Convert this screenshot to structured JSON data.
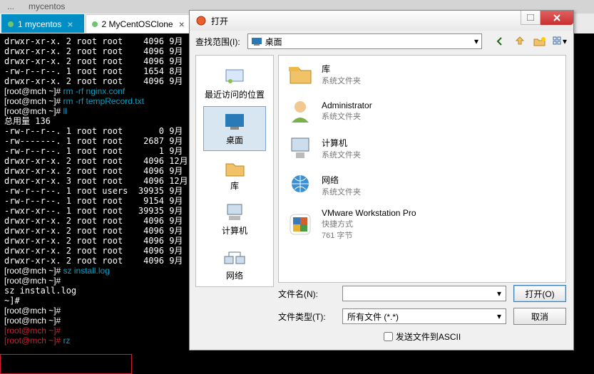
{
  "top_tabs": [
    "...",
    "mycentos",
    "..."
  ],
  "session_tabs": [
    {
      "label": "1 mycentos",
      "active": true
    },
    {
      "label": "2 MyCentOSClone",
      "active": false
    }
  ],
  "terminal_lines": [
    {
      "c": "w",
      "t": "drwxr-xr-x. 2 root root    4096 9月"
    },
    {
      "c": "w",
      "t": "drwxr-xr-x. 2 root root    4096 9月"
    },
    {
      "c": "w",
      "t": "drwxr-xr-x. 2 root root    4096 9月"
    },
    {
      "c": "w",
      "t": "-rw-r--r--. 1 root root    1654 8月"
    },
    {
      "c": "w",
      "t": "drwxr-xr-x. 2 root root    4096 9月"
    },
    {
      "c": "cmd",
      "p": "[root@mch ~]# ",
      "t": "rm -rf nginx.conf"
    },
    {
      "c": "cmd",
      "p": "[root@mch ~]# ",
      "t": "rm -rf tempRecord.txt"
    },
    {
      "c": "cmd",
      "p": "[root@mch ~]# ",
      "t": "ll"
    },
    {
      "c": "w",
      "t": "总用量 136"
    },
    {
      "c": "w",
      "t": "-rw-r--r--. 1 root root       0 9月"
    },
    {
      "c": "w",
      "t": "-rw-------. 1 root root    2687 9月"
    },
    {
      "c": "w",
      "t": "-rw-r--r--. 1 root root       1 9月"
    },
    {
      "c": "w",
      "t": "drwxr-xr-x. 2 root root    4096 12月"
    },
    {
      "c": "w",
      "t": "drwxr-xr-x. 2 root root    4096 9月"
    },
    {
      "c": "w",
      "t": "drwxr-xr-x. 3 root root    4096 12月"
    },
    {
      "c": "w",
      "t": "-rw-r--r--. 1 root users  39935 9月"
    },
    {
      "c": "w",
      "t": "-rw-r--r--. 1 root root    9154 9月"
    },
    {
      "c": "w",
      "t": "-rwxr-xr--. 1 root root   39935 9月"
    },
    {
      "c": "w",
      "t": "drwxr-xr-x. 2 root root    4096 9月"
    },
    {
      "c": "w",
      "t": "drwxr-xr-x. 2 root root    4096 9月"
    },
    {
      "c": "w",
      "t": "drwxr-xr-x. 2 root root    4096 9月"
    },
    {
      "c": "w",
      "t": "drwxr-xr-x. 2 root root    4096 9月"
    },
    {
      "c": "w",
      "t": "drwxr-xr-x. 2 root root    4096 9月"
    },
    {
      "c": "cmd",
      "p": "[root@mch ~]# ",
      "t": "sz install.log"
    },
    {
      "c": "cmd",
      "p": "[root@mch ~]# ",
      "t": ""
    },
    {
      "c": "w",
      "t": "sz install.log"
    },
    {
      "c": "w",
      "t": "~]#"
    },
    {
      "c": "cmd",
      "p": "[root@mch ~]#",
      "t": ""
    },
    {
      "c": "cmd",
      "p": "[root@mch ~]#",
      "t": ""
    },
    {
      "c": "redcmd",
      "p": "[root@mch ~]#",
      "t": ""
    },
    {
      "c": "redcmd",
      "p": "[root@mch ~]# ",
      "t": "rz"
    }
  ],
  "dialog": {
    "title": "打开",
    "locbar_label": "查找范围(I):",
    "location": "桌面",
    "sidebar": [
      {
        "label": "最近访问的位置",
        "sel": false
      },
      {
        "label": "桌面",
        "sel": true
      },
      {
        "label": "库",
        "sel": false
      },
      {
        "label": "计算机",
        "sel": false
      },
      {
        "label": "网络",
        "sel": false
      }
    ],
    "files": [
      {
        "name": "库",
        "sub": "系统文件夹",
        "ico": "lib"
      },
      {
        "name": "Administrator",
        "sub": "系统文件夹",
        "ico": "user"
      },
      {
        "name": "计算机",
        "sub": "系统文件夹",
        "ico": "pc"
      },
      {
        "name": "网络",
        "sub": "系统文件夹",
        "ico": "net"
      },
      {
        "name": "VMware Workstation Pro",
        "sub": "快捷方式",
        "sub2": "761 字节",
        "ico": "vm"
      }
    ],
    "filename_label": "文件名(N):",
    "filetype_label": "文件类型(T):",
    "filetype_value": "所有文件 (*.*)",
    "open_button": "打开(O)",
    "cancel_button": "取消",
    "ascii_checkbox": "发送文件到ASCII"
  }
}
